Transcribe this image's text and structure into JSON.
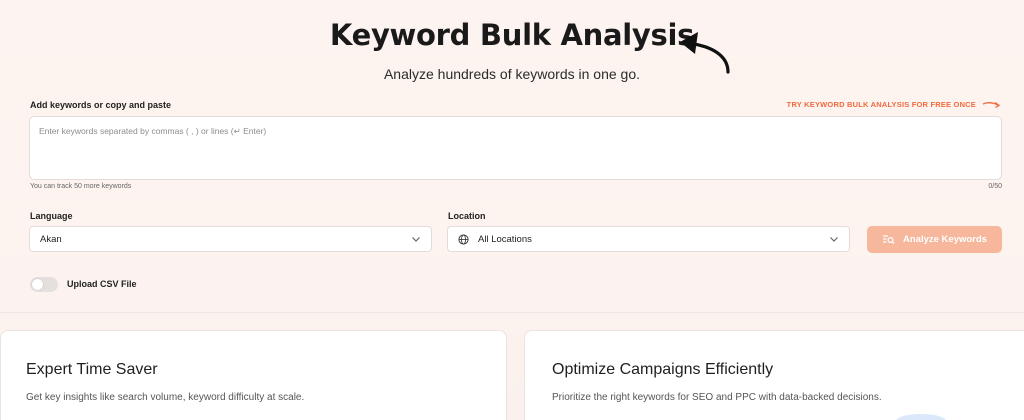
{
  "header": {
    "title": "Keyword Bulk Analysis",
    "subtitle": "Analyze hundreds of keywords in one go."
  },
  "keywords": {
    "label": "Add keywords or copy and paste",
    "try_link": "TRY KEYWORD BULK ANALYSIS FOR FREE ONCE",
    "placeholder": "Enter keywords separated by commas ( , ) or lines (↵ Enter)",
    "helper": "You can track 50 more keywords",
    "counter": "0/50"
  },
  "language": {
    "label": "Language",
    "value": "Akan"
  },
  "location": {
    "label": "Location",
    "value": "All Locations"
  },
  "analyze_button": "Analyze Keywords",
  "upload": {
    "label": "Upload CSV File",
    "enabled": false
  },
  "cards": [
    {
      "title": "Expert Time Saver",
      "description": "Get key insights like search volume, keyword difficulty at scale."
    },
    {
      "title": "Optimize Campaigns Efficiently",
      "description": "Prioritize the right keywords for SEO and PPC with data-backed decisions."
    }
  ],
  "colors": {
    "accent": "#f26a3d",
    "button_bg": "#f6b79c",
    "page_bg": "#fdf4f1"
  }
}
